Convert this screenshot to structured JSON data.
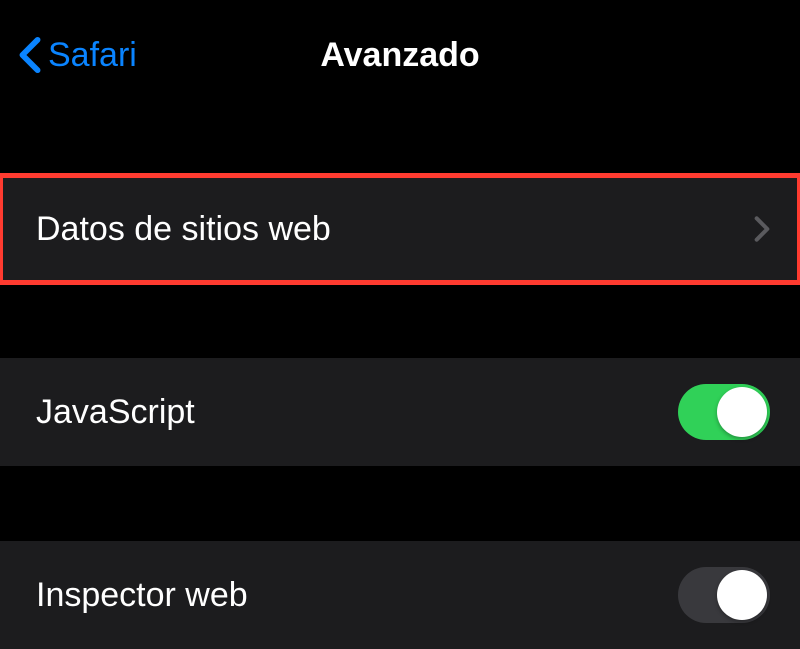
{
  "header": {
    "back_label": "Safari",
    "title": "Avanzado"
  },
  "rows": {
    "website_data": {
      "label": "Datos de sitios web"
    },
    "javascript": {
      "label": "JavaScript",
      "enabled": true
    },
    "web_inspector": {
      "label": "Inspector web",
      "enabled": false
    }
  },
  "colors": {
    "accent": "#0a84ff",
    "toggle_on": "#30d158",
    "highlight": "#ff3b30",
    "cell_bg": "#1c1c1e"
  }
}
